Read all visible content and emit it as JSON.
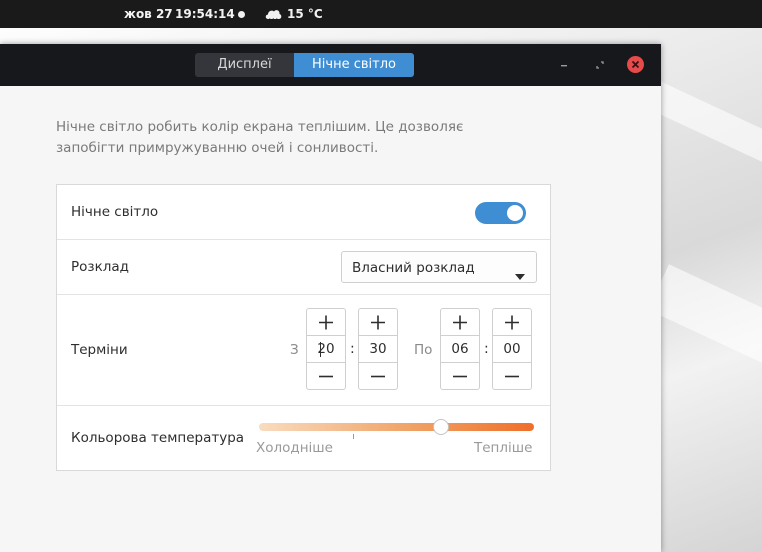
{
  "topbar": {
    "date": "жов 27",
    "time": "19:54:14",
    "weather_icon": "cloud-icon",
    "temperature": "15 °C"
  },
  "window": {
    "tabs": [
      {
        "label": "Дисплеї",
        "active": false
      },
      {
        "label": "Нічне світло",
        "active": true
      }
    ],
    "controls": [
      "minimize-icon",
      "maximize-icon",
      "close-icon"
    ]
  },
  "description": "Нічне світло робить колір екрана теплішим. Це дозволяє запобігти примружуванню очей і сонливості.",
  "settings": {
    "night_light": {
      "label": "Нічне світло",
      "enabled": true
    },
    "schedule": {
      "label": "Розклад",
      "value": "Власний розклад"
    },
    "times": {
      "label": "Терміни",
      "from_label": "З",
      "to_label": "По",
      "from_hours": "20",
      "from_minutes": "30",
      "to_hours": "06",
      "to_minutes": "00",
      "separator": ":"
    },
    "temperature": {
      "label": "Кольорова температура",
      "cooler_label": "Холодніше",
      "warmer_label": "Тепліше",
      "level": 0.66
    }
  },
  "colors": {
    "accent": "#3f8ed4",
    "close": "#e64a4a",
    "titlebar": "#16181c"
  }
}
